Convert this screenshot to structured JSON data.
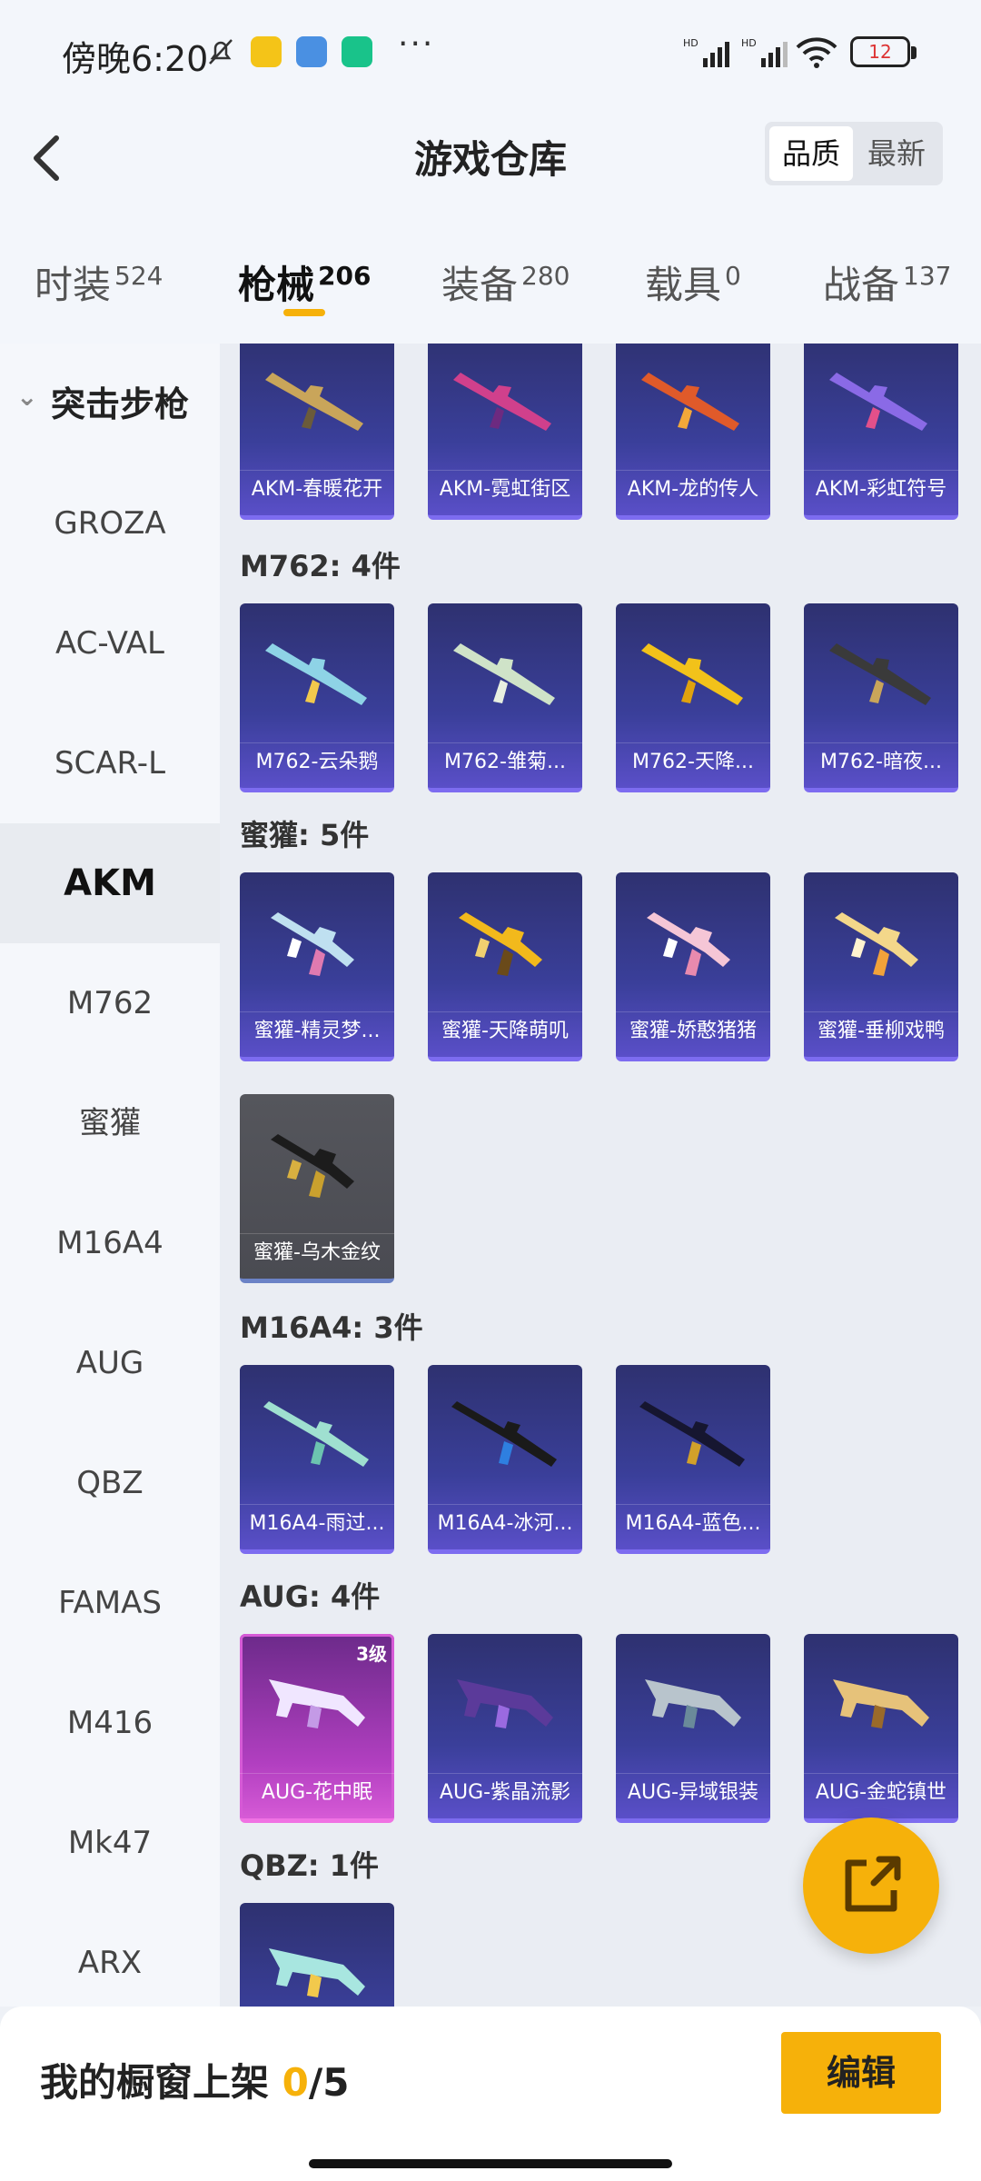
{
  "status": {
    "time": "傍晚6:20",
    "battery": "12"
  },
  "header": {
    "title": "游戏仓库",
    "sort_quality": "品质",
    "sort_latest": "最新"
  },
  "tabs": [
    {
      "label": "时装",
      "count": "524"
    },
    {
      "label": "枪械",
      "count": "206"
    },
    {
      "label": "装备",
      "count": "280"
    },
    {
      "label": "载具",
      "count": "0"
    },
    {
      "label": "战备",
      "count": "137"
    }
  ],
  "sidebar": {
    "category": "突击步枪",
    "items": [
      "GROZA",
      "AC-VAL",
      "SCAR-L",
      "AKM",
      "M762",
      "蜜獾",
      "M16A4",
      "AUG",
      "QBZ",
      "FAMAS",
      "M416",
      "Mk47",
      "ARX"
    ]
  },
  "sections": {
    "akm": {
      "items": [
        "AKM-春暖花开",
        "AKM-霓虹街区",
        "AKM-龙的传人",
        "AKM-彩虹符号"
      ]
    },
    "m762": {
      "header": "M762: 4件",
      "items": [
        "M762-云朵鹅",
        "M762-雏菊...",
        "M762-天降...",
        "M762-暗夜..."
      ]
    },
    "honey": {
      "header": "蜜獾: 5件",
      "items": [
        "蜜獾-精灵梦...",
        "蜜獾-天降萌叽",
        "蜜獾-娇憨猪猪",
        "蜜獾-垂柳戏鸭",
        "蜜獾-乌木金纹"
      ]
    },
    "m16": {
      "header": "M16A4: 3件",
      "items": [
        "M16A4-雨过...",
        "M16A4-冰河...",
        "M16A4-蓝色..."
      ]
    },
    "aug": {
      "header": "AUG: 4件",
      "items": [
        "AUG-花中眠",
        "AUG-紫晶流影",
        "AUG-异域银装",
        "AUG-金蛇镇世"
      ],
      "level": "3级"
    },
    "qbz": {
      "header": "QBZ: 1件"
    }
  },
  "bottom": {
    "label": "我的橱窗上架",
    "count_current": "0",
    "count_total": "/5",
    "edit": "编辑"
  },
  "colors": {
    "accent": "#f6b10a",
    "card_purple": "#3a3f9a",
    "card_pink": "#b13fc0"
  }
}
